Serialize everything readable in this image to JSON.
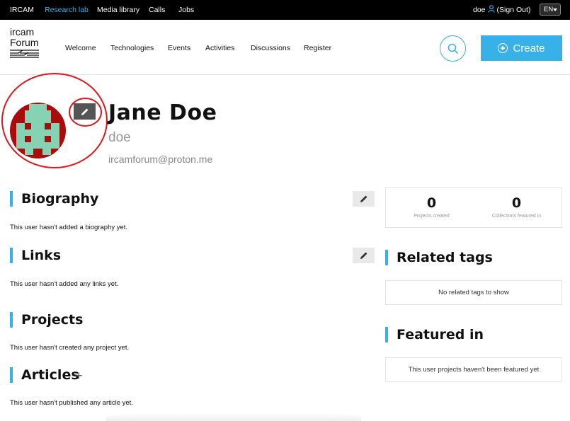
{
  "topbar": {
    "links": [
      "IRCAM",
      "Research lab",
      "Media library",
      "Calls",
      "Jobs"
    ],
    "active_link": "Research lab",
    "user_name": "doe",
    "sign_out": "(Sign Out)",
    "language": "EN",
    "accent_color": "#38b1e8"
  },
  "header": {
    "logo_line1": "ircam",
    "logo_line2": "Forum",
    "nav": [
      "Welcome",
      "Technologies",
      "Events",
      "Activities",
      "Discussions",
      "Register"
    ],
    "search_icon": "search-icon",
    "create_label": "Create"
  },
  "profile": {
    "name": "Jane Doe",
    "username": "doe",
    "email": "ircamforum@proton.me",
    "avatar_color": "#a80d0d",
    "avatar_pattern_color": "#86d3b4",
    "annotation_color": "#e0161b"
  },
  "sections": {
    "biography_title": "Biography",
    "biography_text": "This user hasn't added a biography yet.",
    "links_title": "Links",
    "links_text": "This user hasn't added any links yet.",
    "projects_title": "Projects",
    "projects_text": "This user hasn't created any project yet.",
    "articles_title": "Articles",
    "articles_add": "+",
    "articles_text": "This user hasn't published any article yet."
  },
  "sidebar": {
    "stats": [
      {
        "value": "0",
        "label": "Projects created"
      },
      {
        "value": "0",
        "label": "Collections featured in"
      }
    ],
    "related_tags_title": "Related tags",
    "related_tags_text": "No related tags to show",
    "featured_title": "Featured in",
    "featured_text": "This user projects haven't been featured yet"
  }
}
